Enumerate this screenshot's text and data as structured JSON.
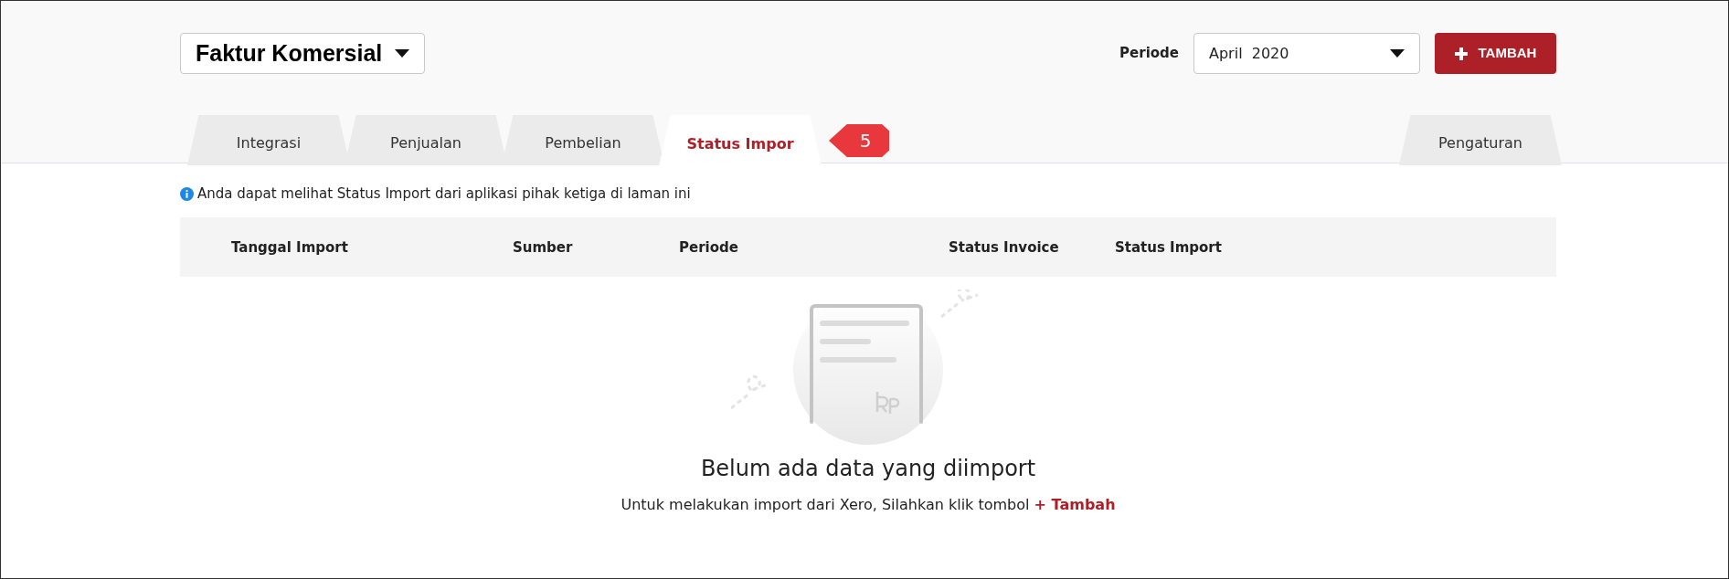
{
  "header": {
    "title": "Faktur Komersial",
    "period_label": "Periode",
    "period_value": "April  2020",
    "add_button": "TAMBAH"
  },
  "tabs": [
    {
      "label": "Integrasi",
      "selected": false
    },
    {
      "label": "Penjualan",
      "selected": false
    },
    {
      "label": "Pembelian",
      "selected": false
    },
    {
      "label": "Status Impor",
      "selected": true
    }
  ],
  "callout": {
    "label": "5"
  },
  "settings_tab": {
    "label": "Pengaturan",
    "selected": false
  },
  "info": "Anda dapat melihat Status Import dari aplikasi pihak ketiga di laman ini",
  "table": {
    "columns": [
      "Tanggal Import",
      "Sumber",
      "Periode",
      "Status Invoice",
      "Status Import"
    ]
  },
  "empty_state": {
    "title": "Belum ada data yang diimport",
    "message": "Untuk melakukan import dari Xero, Silahkan klik tombol",
    "link": "+ Tambah"
  }
}
